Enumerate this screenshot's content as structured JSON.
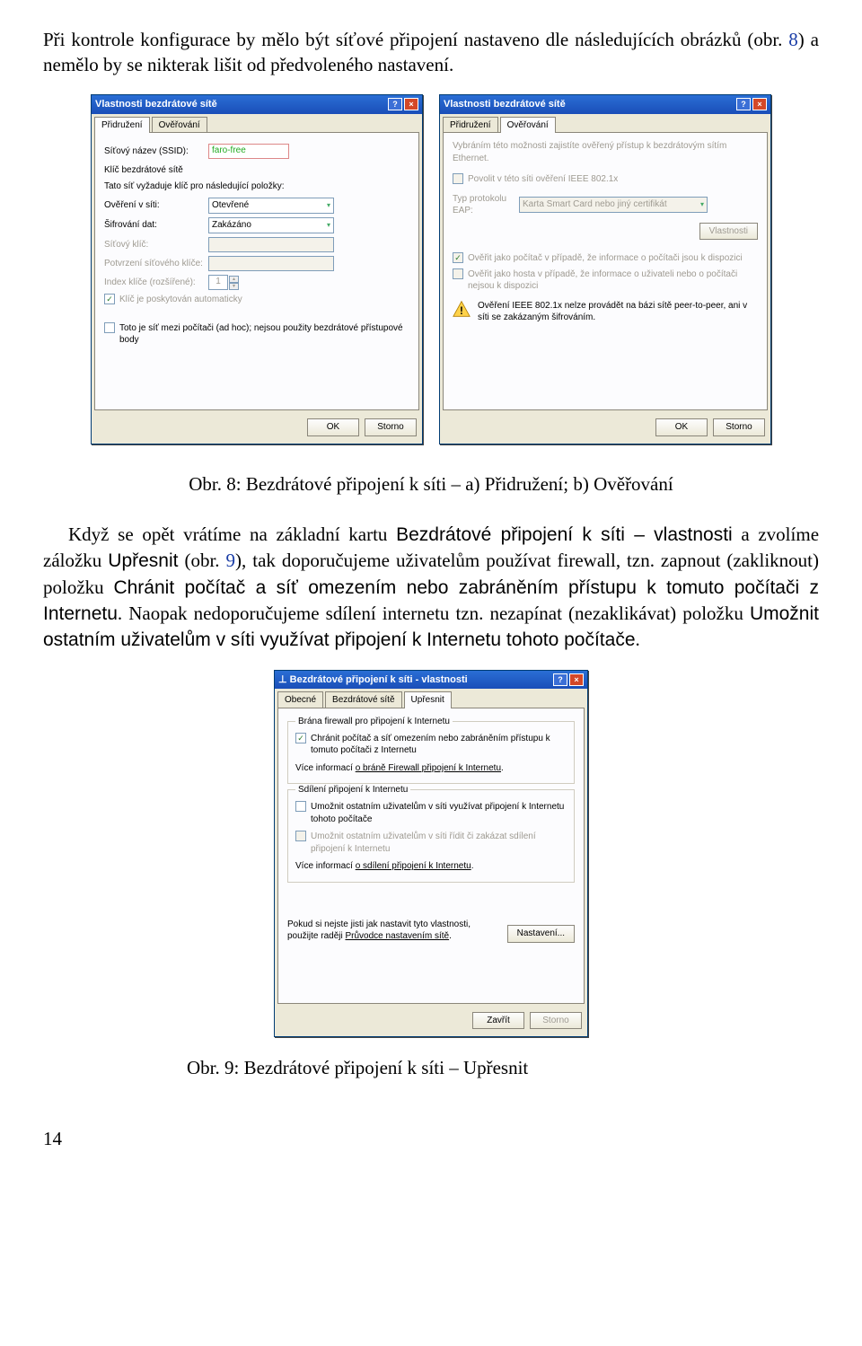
{
  "para1": "Při kontrole konfigurace by mělo být síťové připojení nastaveno dle následujících obrázků (obr. ",
  "para1_ref": "8",
  "para1_tail": ") a nemělo by se nikterak lišit od předvoleného nastavení.",
  "dlgA": {
    "title": "Vlastnosti bezdrátové sítě",
    "tab1": "Přidružení",
    "tab2": "Ověřování",
    "ssid_lbl": "Síťový název (SSID):",
    "ssid_val": "faro-free",
    "key_hdr": "Klíč bezdrátové sítě",
    "key_note": "Tato síť vyžaduje klíč pro následující položky:",
    "auth_lbl": "Ověření v síti:",
    "auth_val": "Otevřené",
    "enc_lbl": "Šifrování dat:",
    "enc_val": "Zakázáno",
    "netkey_lbl": "Síťový klíč:",
    "confkey_lbl": "Potvrzení síťového klíče:",
    "idx_lbl": "Index klíče (rozšířené):",
    "idx_val": "1",
    "autokey": "Klíč je poskytován automaticky",
    "adhoc": "Toto je síť mezi počítači (ad hoc); nejsou použity bezdrátové přístupové body",
    "ok": "OK",
    "cancel": "Storno"
  },
  "dlgB": {
    "title": "Vlastnosti bezdrátové sítě",
    "tab1": "Přidružení",
    "tab2": "Ověřování",
    "intro": "Vybráním této možnosti zajistíte ověřený přístup k bezdrátovým sítím Ethernet.",
    "enable8021x": "Povolit v této síti ověření IEEE 802.1x",
    "eap_lbl": "Typ protokolu EAP:",
    "eap_val": "Karta Smart Card nebo jiný certifikát",
    "props": "Vlastnosti",
    "asComputer": "Ověřit jako počítač v případě, že informace o počítači jsou k dispozici",
    "asGuest": "Ověřit jako hosta v případě, že informace o uživateli nebo o počítači nejsou k dispozici",
    "warn": "Ověření IEEE 802.1x nelze provádět na bázi sítě peer-to-peer, ani v síti se zakázaným šifrováním.",
    "ok": "OK",
    "cancel": "Storno"
  },
  "cap8": "Obr. 8: Bezdrátové připojení k síti – a) Přidružení; b) Ověřování",
  "para2a": "Když se opět vrátíme na základní kartu ",
  "para2b": "Bezdrátové připojení k síti – vlastnosti",
  "para2c": " a zvolíme záložku ",
  "para2d": "Upřesnit",
  "para2e": " (obr. ",
  "para2_ref": "9",
  "para2f": "), tak doporučujeme uživatelům používat firewall, tzn. zapnout (zakliknout) položku ",
  "para2g": "Chránit počítač a síť omezením nebo zabráněním přístupu k tomuto počítači z Internetu",
  "para2h": ". Naopak nedoporučujeme sdílení internetu tzn. nezapínat (nezaklikávat) položku ",
  "para2i": "Umožnit ostatním uživatelům v síti využívat připojení k Internetu tohoto počítače",
  "para2j": ".",
  "dlgC": {
    "title": "Bezdrátové připojení k síti - vlastnosti",
    "tab1": "Obecné",
    "tab2": "Bezdrátové sítě",
    "tab3": "Upřesnit",
    "g1_legend": "Brána firewall pro připojení k Internetu",
    "g1_chk": "Chránit počítač a síť omezením nebo zabráněním přístupu k tomuto počítači z Internetu",
    "g1_link_pre": "Více informací ",
    "g1_link": "o bráně Firewall připojení k Internetu",
    "g2_legend": "Sdílení připojení k Internetu",
    "g2_chk": "Umožnit ostatním uživatelům v síti využívat připojení k Internetu tohoto počítače",
    "g2_chk2": "Umožnit ostatním uživatelům v síti řídit či zakázat sdílení připojení k Internetu",
    "g2_link_pre": "Více informací ",
    "g2_link": "o sdílení připojení k Internetu",
    "wiz_txt": "Pokud si nejste jisti jak nastavit tyto vlastnosti, použijte raději ",
    "wiz_link": "Průvodce nastavením sítě",
    "wiz_btn": "Nastavení...",
    "close": "Zavřít",
    "cancel": "Storno"
  },
  "cap9": "Obr. 9: Bezdrátové připojení k síti – Upřesnit",
  "pagenum": "14"
}
